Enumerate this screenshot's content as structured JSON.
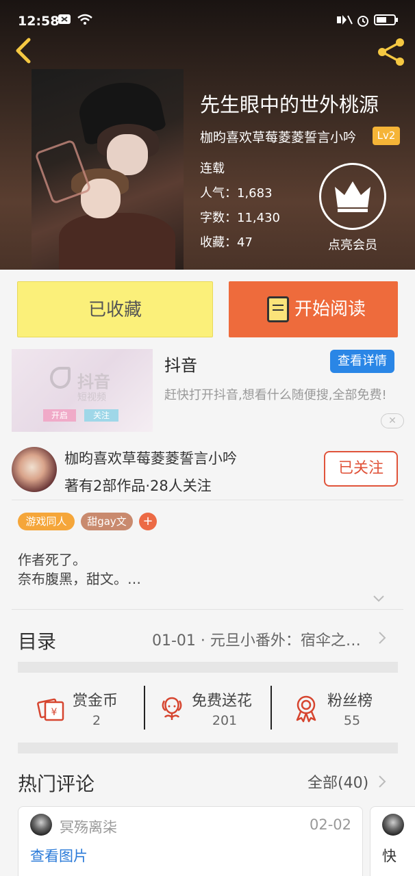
{
  "status_bar": {
    "time": "12:58"
  },
  "book": {
    "title": "先生眼中的世外桃源",
    "author": "枷昀喜欢草莓菱菱誓言小吟",
    "author_level": "Lv2",
    "status": "连载",
    "popularity": "人气：1,683",
    "word_count": "字数：11,430",
    "favorites": "收藏：47",
    "vip_label": "点亮会员"
  },
  "actions": {
    "collected": "已收藏",
    "start_reading": "开始阅读"
  },
  "ad": {
    "title": "抖音",
    "detail_button": "查看详情",
    "description": "赶快打开抖音,想看什么随便搜,全部免费!",
    "image_brand": "抖音",
    "image_sub": "短视频",
    "image_chip1": "开启",
    "image_chip2": "关注"
  },
  "author_card": {
    "name": "枷昀喜欢草莓菱菱誓言小吟",
    "meta": "著有2部作品·28人关注",
    "follow_button": "已关注"
  },
  "tags": [
    {
      "label": "游戏同人",
      "color": "#f5a63a"
    },
    {
      "label": "甜gay文",
      "color": "#c98a6e"
    }
  ],
  "tag_add": "+",
  "intro": "作者死了。\n奈布腹黑，甜文。…",
  "catalog": {
    "label": "目录",
    "latest": "01-01 · 元旦小番外：宿伞之…"
  },
  "stats": [
    {
      "label": "赏金币",
      "value": "2",
      "icon": "coin-envelope-icon"
    },
    {
      "label": "免费送花",
      "value": "201",
      "icon": "flower-icon"
    },
    {
      "label": "粉丝榜",
      "value": "55",
      "icon": "medal-icon"
    }
  ],
  "comments": {
    "title": "热门评论",
    "all": "全部(40)",
    "items": [
      {
        "name": "冥殇离柒",
        "date": "02-02",
        "link": "查看图片"
      },
      {
        "name": "",
        "date": "",
        "link": "快"
      }
    ]
  },
  "colors": {
    "accent_orange": "#ee6b3c",
    "collected_yellow": "#fbf07a",
    "link_blue": "#2a86e6",
    "follow_red": "#e0533a"
  }
}
